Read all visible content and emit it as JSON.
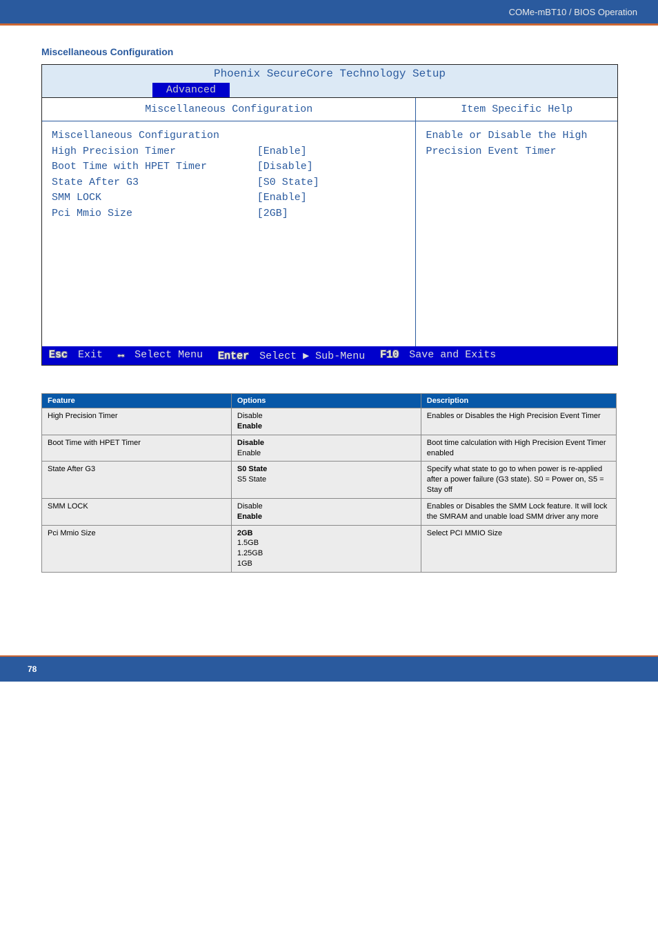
{
  "header": {
    "text": "COMe-mBT10 / BIOS Operation"
  },
  "section_title": "Miscellaneous Configuration",
  "bios": {
    "title": "Phoenix SecureCore Technology Setup",
    "active_tab": "Advanced",
    "main_heading": "Miscellaneous Configuration",
    "side_heading": "Item Specific Help",
    "group_label": "Miscellaneous Configuration",
    "items": [
      {
        "label": "High Precision Timer",
        "value": "[Enable]"
      },
      {
        "label": "Boot Time with HPET Timer",
        "value": "[Disable]"
      },
      {
        "label": "State After G3",
        "value": "[S0 State]"
      },
      {
        "label": "SMM LOCK",
        "value": "[Enable]"
      },
      {
        "label": "Pci Mmio Size",
        "value": "[2GB]"
      }
    ],
    "help_text": "Enable or Disable the High Precision Event Timer",
    "footer": {
      "esc": {
        "key": "Esc",
        "label": "Exit"
      },
      "arrows": {
        "key": "↔",
        "label": "Select Menu"
      },
      "enter": {
        "key": "Enter",
        "label": "Select ▶ Sub-Menu"
      },
      "f10": {
        "key": "F10",
        "label": "Save and Exits"
      }
    }
  },
  "table": {
    "headers": {
      "feature": "Feature",
      "options": "Options",
      "description": "Description"
    },
    "rows": [
      {
        "feature": "High Precision Timer",
        "options": "Disable\nEnable",
        "options_bold": [
          false,
          true
        ],
        "description": "Enables or Disables the High Precision Event Timer"
      },
      {
        "feature": "Boot Time with HPET Timer",
        "options": "Disable\nEnable",
        "options_bold": [
          true,
          false
        ],
        "description": "Boot time calculation with High Precision Event Timer enabled"
      },
      {
        "feature": "State After G3",
        "options": "S0 State\nS5 State",
        "options_bold": [
          true,
          false
        ],
        "description": "Specify what state to go to when power is re-applied after a power failure (G3 state). S0 = Power on, S5 = Stay off"
      },
      {
        "feature": "SMM LOCK",
        "options": "Disable\nEnable",
        "options_bold": [
          false,
          true
        ],
        "description": "Enables or Disables the SMM Lock feature. It will lock the SMRAM and unable load SMM driver any more"
      },
      {
        "feature": "Pci Mmio Size",
        "options": "2GB\n1.5GB\n1.25GB\n1GB",
        "options_bold": [
          true,
          false,
          false,
          false
        ],
        "description": "Select PCI MMIO Size"
      }
    ]
  },
  "footer": {
    "page_number": "78"
  }
}
